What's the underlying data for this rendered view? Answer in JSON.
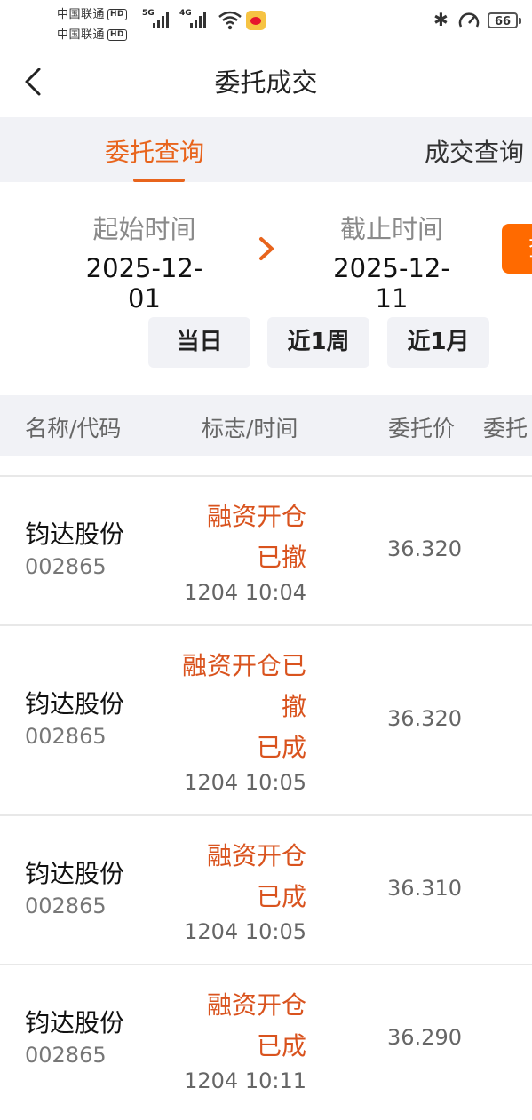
{
  "status": {
    "carrier1": "中国联通",
    "carrier2": "中国联通",
    "hd": "HD",
    "net1": "5G",
    "net2": "4G",
    "battery": "66"
  },
  "nav": {
    "title": "委托成交"
  },
  "tabs": [
    {
      "label": "委托查询",
      "active": true
    },
    {
      "label": "成交查询",
      "active": false
    }
  ],
  "range": {
    "start_label": "起始时间",
    "start_value": "2025-12-01",
    "end_label": "截止时间",
    "end_value": "2025-12-11",
    "query_label": "查",
    "quick": [
      "当日",
      "近1周",
      "近1月"
    ]
  },
  "columns": [
    "名称/代码",
    "标志/时间",
    "委托价",
    "委托"
  ],
  "rows": [
    {
      "name": "钧达股份",
      "code": "002865",
      "flag_lines": [
        "融资开仓",
        "已撤"
      ],
      "time": "1204 10:04",
      "price": "36.320"
    },
    {
      "name": "钧达股份",
      "code": "002865",
      "flag_lines": [
        "融资开仓已",
        "撤",
        "已成"
      ],
      "time": "1204 10:05",
      "price": "36.320"
    },
    {
      "name": "钧达股份",
      "code": "002865",
      "flag_lines": [
        "融资开仓",
        "已成"
      ],
      "time": "1204 10:05",
      "price": "36.310"
    },
    {
      "name": "钧达股份",
      "code": "002865",
      "flag_lines": [
        "融资开仓",
        "已成"
      ],
      "time": "1204 10:11",
      "price": "36.290"
    }
  ],
  "colors": {
    "accent": "#e8641c",
    "query_button": "#ff6a00",
    "flag_text": "#d9531e"
  }
}
